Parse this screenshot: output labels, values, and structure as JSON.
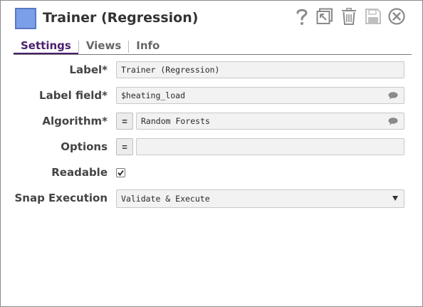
{
  "header": {
    "title": "Trainer (Regression)",
    "swatch_color": "#7b9fe8",
    "toolbar": [
      {
        "name": "help-icon"
      },
      {
        "name": "export-icon"
      },
      {
        "name": "trash-icon"
      },
      {
        "name": "save-icon"
      },
      {
        "name": "close-icon"
      }
    ]
  },
  "tabs": [
    {
      "label": "Settings",
      "active": true
    },
    {
      "label": "Views",
      "active": false
    },
    {
      "label": "Info",
      "active": false
    }
  ],
  "form": {
    "label": {
      "label": "Label*",
      "value": "Trainer (Regression)"
    },
    "label_field": {
      "label": "Label field*",
      "value": "$heating_load"
    },
    "algorithm": {
      "label": "Algorithm*",
      "expr": "=",
      "value": "Random Forests"
    },
    "options": {
      "label": "Options",
      "expr": "=",
      "value": ""
    },
    "readable": {
      "label": "Readable",
      "checked": true
    },
    "snap_execution": {
      "label": "Snap Execution",
      "value": "Validate & Execute"
    }
  },
  "colors": {
    "accent": "#4a1f6e",
    "field_bg": "#f2f2f2"
  }
}
